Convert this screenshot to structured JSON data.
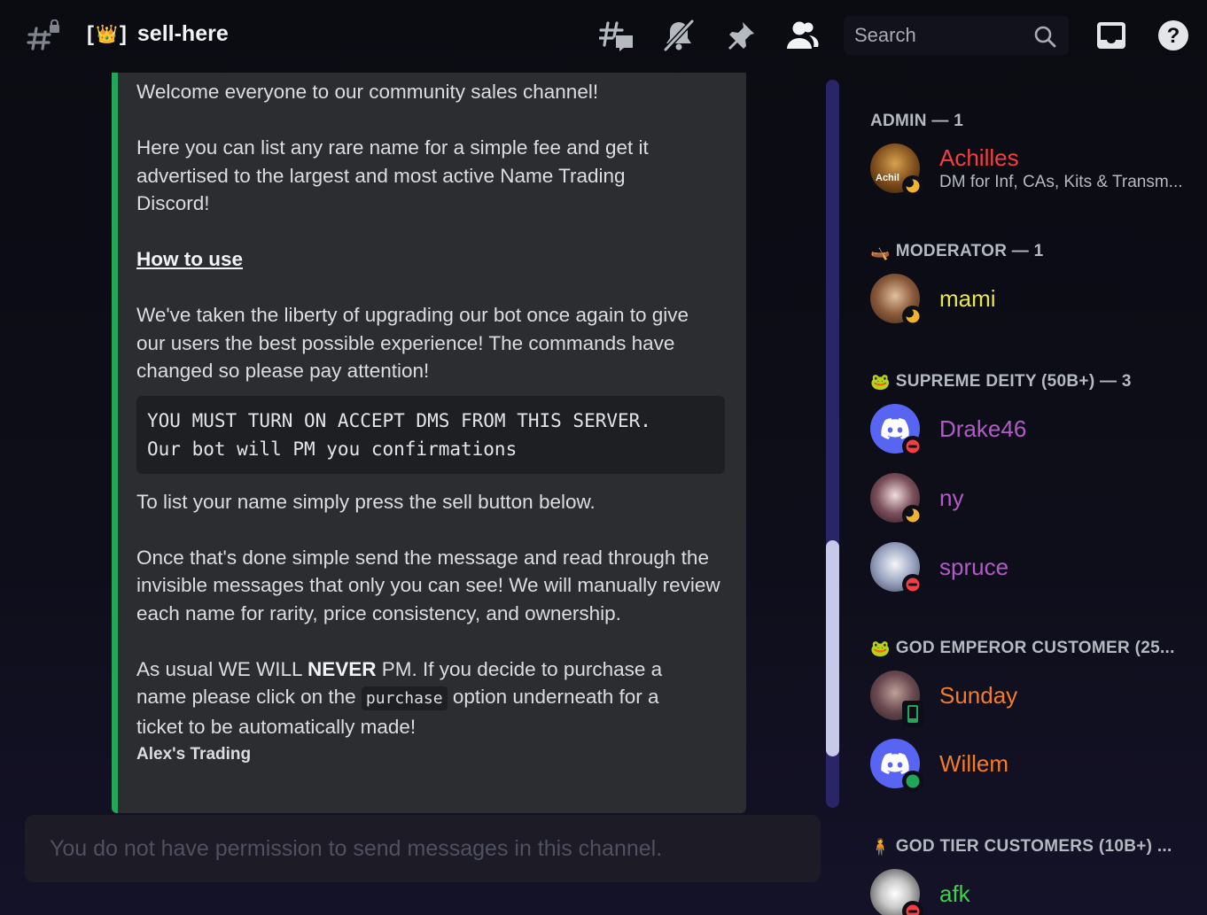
{
  "header": {
    "channel_bracket_open": "[",
    "channel_crown": "👑",
    "channel_bracket_close": "]",
    "channel_name": "sell-here",
    "search_placeholder": "Search",
    "icons": [
      "threads-icon",
      "notification-muted-icon",
      "pin-icon",
      "member-list-icon",
      "search-icon",
      "inbox-icon",
      "help-icon"
    ]
  },
  "embed": {
    "accent_color": "#23a55a",
    "intro": "Welcome everyone to our community sales channel!",
    "para1": "Here you can list any rare name for a simple fee and get it advertised to the largest and most active Name Trading Discord!",
    "how_to_use": "How to use",
    "para2": "We've taken the liberty of upgrading our bot once again to give our users the best possible experience! The commands have changed so please pay attention!",
    "code_line1": "YOU MUST TURN ON ACCEPT DMS FROM THIS SERVER.",
    "code_line2": "Our bot will PM you confirmations",
    "para3": "To list your name simply press the sell button below.",
    "para4": "Once that's done simple send the message and read through the invisible messages that only you can see! We will manually review each name for rarity, price consistency, and ownership.",
    "para5_a": "As usual WE WILL ",
    "para5_bold": "NEVER",
    "para5_b": " PM. If you decide to purchase a name please click on the ",
    "para5_code": "purchase",
    "para5_c": " option underneath for a ticket to be automatically made!",
    "footer": "Alex's Trading"
  },
  "composer": {
    "placeholder": "You do not have permission to send messages in this channel."
  },
  "members": {
    "groups": [
      {
        "header": "ADMIN — 1",
        "emoji": "",
        "members": [
          {
            "name": "Achilles",
            "color": "#f23f43",
            "status_text": "DM for Inf, CAs, Kits & Transm...",
            "presence": "idle",
            "avatar_label": "Achil"
          }
        ]
      },
      {
        "header": "MODERATOR — 1",
        "emoji": "🛶",
        "members": [
          {
            "name": "mami",
            "color": "#e8e84a",
            "status_text": "",
            "presence": "idle"
          }
        ]
      },
      {
        "header": "SUPREME DEITY (50B+) — 3",
        "emoji": "🐸",
        "members": [
          {
            "name": "Drake46",
            "color": "#b05cc4",
            "status_text": "",
            "presence": "dnd"
          },
          {
            "name": "ny",
            "color": "#b05cc4",
            "status_text": "",
            "presence": "idle"
          },
          {
            "name": "spruce",
            "color": "#b05cc4",
            "status_text": "",
            "presence": "dnd"
          }
        ]
      },
      {
        "header": "GOD EMPEROR CUSTOMER (25...",
        "emoji": "🐸",
        "members": [
          {
            "name": "Sunday",
            "color": "#f47b2a",
            "status_text": "",
            "presence": "mobile"
          },
          {
            "name": "Willem",
            "color": "#f47b2a",
            "status_text": "",
            "presence": "online"
          }
        ]
      },
      {
        "header": "GOD TIER CUSTOMERS (10B+) ...",
        "emoji": "🧍",
        "members": [
          {
            "name": "afk",
            "color": "#3ed24a",
            "status_text": "",
            "presence": "dnd"
          }
        ]
      }
    ]
  },
  "colors": {
    "idle": "#f0b232",
    "dnd": "#f23f43",
    "online": "#23a55a",
    "discord_blurple": "#5865f2"
  }
}
